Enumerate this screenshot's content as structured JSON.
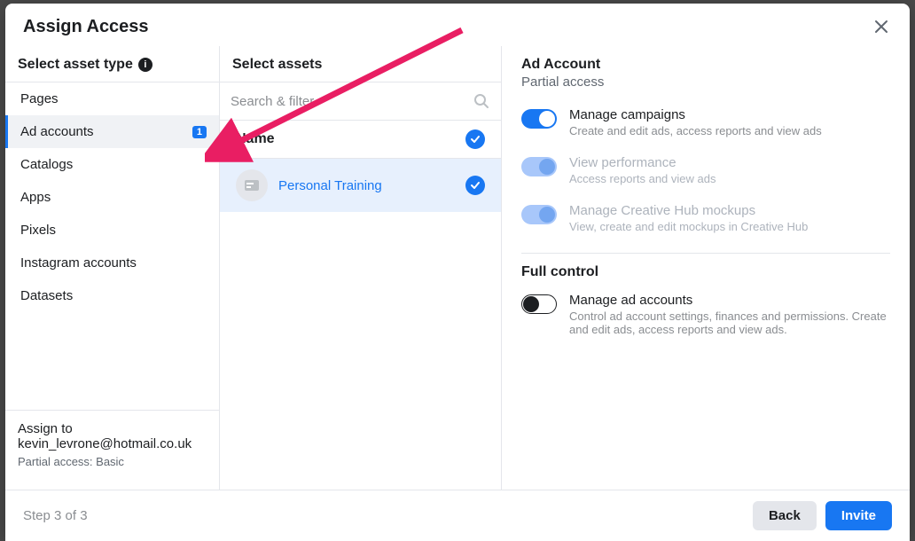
{
  "modal": {
    "title": "Assign Access",
    "step_text": "Step 3 of 3",
    "back_label": "Back",
    "invite_label": "Invite"
  },
  "left": {
    "header": "Select asset type",
    "items": [
      {
        "label": "Pages",
        "selected": false,
        "count": null
      },
      {
        "label": "Ad accounts",
        "selected": true,
        "count": "1"
      },
      {
        "label": "Catalogs",
        "selected": false,
        "count": null
      },
      {
        "label": "Apps",
        "selected": false,
        "count": null
      },
      {
        "label": "Pixels",
        "selected": false,
        "count": null
      },
      {
        "label": "Instagram accounts",
        "selected": false,
        "count": null
      },
      {
        "label": "Datasets",
        "selected": false,
        "count": null
      }
    ],
    "assign_to_label": "Assign to",
    "assign_email": "kevin_levrone@hotmail.co.uk",
    "assign_access": "Partial access: Basic"
  },
  "middle": {
    "header": "Select assets",
    "search_placeholder": "Search & filter",
    "name_header": "Name",
    "assets": [
      {
        "label": "Personal Training",
        "selected": true
      }
    ]
  },
  "right": {
    "title": "Ad Account",
    "partial_label": "Partial access",
    "permissions_partial": [
      {
        "title": "Manage campaigns",
        "desc": "Create and edit ads, access reports and view ads",
        "on": true,
        "disabled": false
      },
      {
        "title": "View performance",
        "desc": "Access reports and view ads",
        "on": true,
        "disabled": true
      },
      {
        "title": "Manage Creative Hub mockups",
        "desc": "View, create and edit mockups in Creative Hub",
        "on": true,
        "disabled": true
      }
    ],
    "full_label": "Full control",
    "permissions_full": [
      {
        "title": "Manage ad accounts",
        "desc": "Control ad account settings, finances and permissions. Create and edit ads, access reports and view ads.",
        "on": false
      }
    ]
  }
}
